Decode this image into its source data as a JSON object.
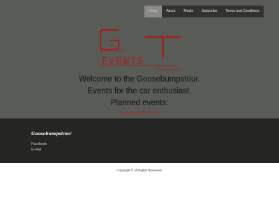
{
  "nav": {
    "items": [
      {
        "label": "Home",
        "active": true
      },
      {
        "label": "About",
        "active": false
      },
      {
        "label": "Media",
        "active": false
      },
      {
        "label": "Subscribe",
        "active": false
      },
      {
        "label": "Terms and Conditions",
        "active": false
      }
    ]
  },
  "logo": {
    "letters": "G T",
    "word": "EVENTS",
    "subtext": "Goosebumpstour",
    "color": "#b01818"
  },
  "hero": {
    "welcome": "Welcome to the Goosebumpstour.",
    "tagline": "Events for the car enthusiast.",
    "planned": "Planned events:",
    "event_link": "The Goosebumps Tour 2022"
  },
  "footer": {
    "brand": "Goosebumpstour",
    "facebook": "Facebook",
    "email": "E-mail"
  },
  "copyright": "Copyright © All Rights Reserved."
}
